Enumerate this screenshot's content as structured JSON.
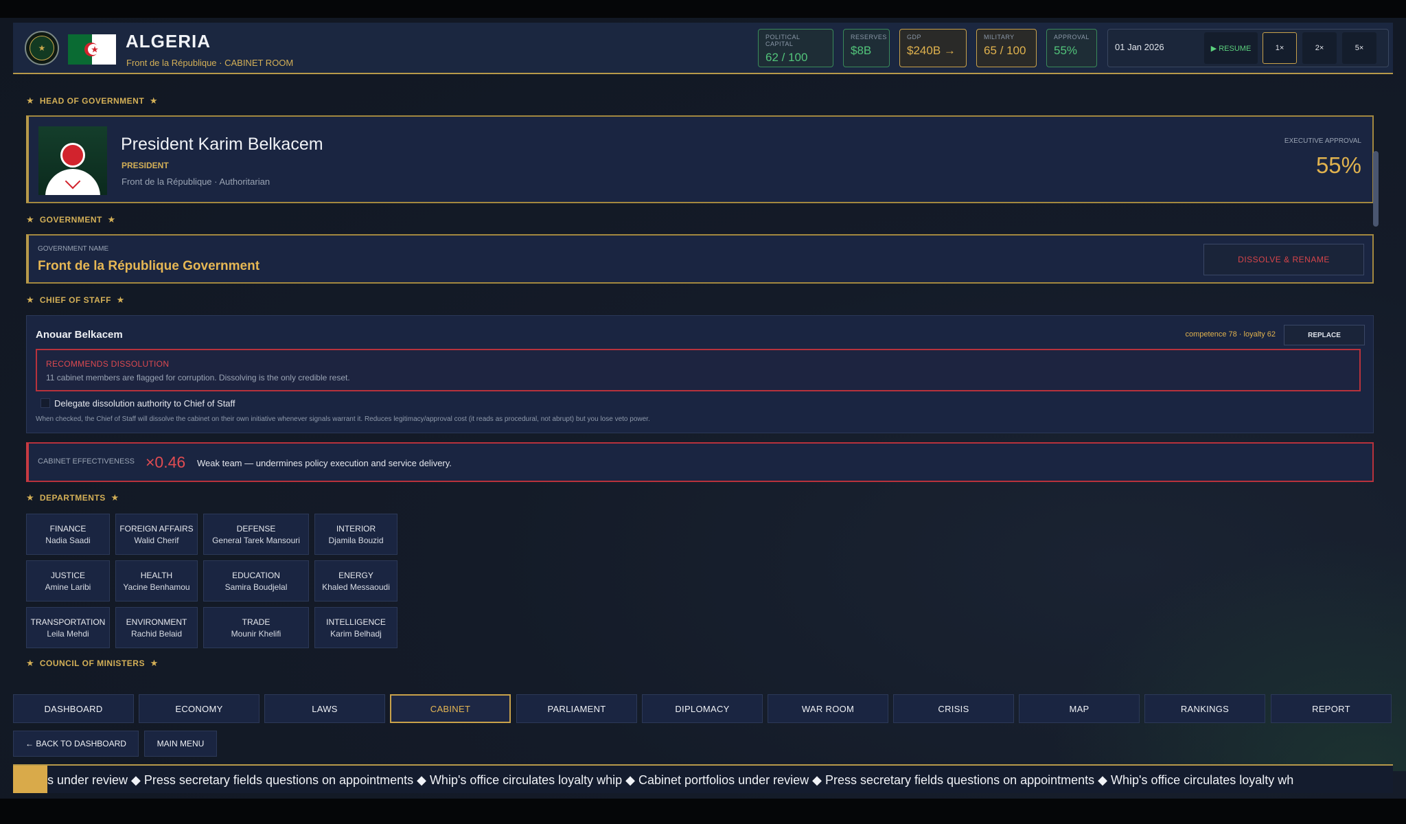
{
  "header": {
    "country": "ALGERIA",
    "subtitle": "Front de la République · CABINET ROOM",
    "stats": {
      "political_capital": {
        "label": "POLITICAL CAPITAL",
        "value": "62 / 100"
      },
      "reserves": {
        "label": "RESERVES",
        "value": "$8B"
      },
      "gdp": {
        "label": "GDP",
        "value": "$240B →"
      },
      "military": {
        "label": "MILITARY",
        "value": "65 / 100"
      },
      "approval": {
        "label": "APPROVAL",
        "value": "55%"
      }
    },
    "date": "01 Jan 2026",
    "resume": "▶ RESUME",
    "speeds": [
      "1×",
      "2×",
      "5×"
    ]
  },
  "sections": {
    "head_of_government": "HEAD OF GOVERNMENT",
    "government": "GOVERNMENT",
    "chief_of_staff": "CHIEF OF STAFF",
    "departments": "DEPARTMENTS",
    "council": "COUNCIL OF MINISTERS"
  },
  "leader": {
    "name": "President Karim Belkacem",
    "role": "PRESIDENT",
    "party": "Front de la République · Authoritarian",
    "approval_label": "EXECUTIVE APPROVAL",
    "approval_value": "55%"
  },
  "government": {
    "label": "GOVERNMENT NAME",
    "name": "Front de la République Government",
    "dissolve_button": "DISSOLVE & RENAME"
  },
  "chief_of_staff": {
    "name": "Anouar Belkacem",
    "stats": "competence 78 · loyalty 62",
    "replace_button": "REPLACE",
    "warning_title": "RECOMMENDS DISSOLUTION",
    "warning_text": "11 cabinet members are flagged for corruption. Dissolving is the only credible reset.",
    "checkbox_label": "Delegate dissolution authority to Chief of Staff",
    "checkbox_desc": "When checked, the Chief of Staff will dissolve the cabinet on their own initiative whenever signals warrant it. Reduces legitimacy/approval cost (it reads as procedural, not abrupt) but you lose veto power."
  },
  "effectiveness": {
    "label": "CABINET EFFECTIVENESS",
    "value": "×0.46",
    "desc": "Weak team — undermines policy execution and service delivery."
  },
  "departments": [
    {
      "dept": "FINANCE",
      "person": "Nadia Saadi"
    },
    {
      "dept": "FOREIGN AFFAIRS",
      "person": "Walid Cherif"
    },
    {
      "dept": "DEFENSE",
      "person": "General Tarek Mansouri"
    },
    {
      "dept": "INTERIOR",
      "person": "Djamila Bouzid"
    },
    {
      "dept": "JUSTICE",
      "person": "Amine Laribi"
    },
    {
      "dept": "HEALTH",
      "person": "Yacine Benhamou"
    },
    {
      "dept": "EDUCATION",
      "person": "Samira Boudjelal"
    },
    {
      "dept": "ENERGY",
      "person": "Khaled Messaoudi"
    },
    {
      "dept": "TRANSPORTATION",
      "person": "Leila Mehdi"
    },
    {
      "dept": "ENVIRONMENT",
      "person": "Rachid Belaid"
    },
    {
      "dept": "TRADE",
      "person": "Mounir Khelifi"
    },
    {
      "dept": "INTELLIGENCE",
      "person": "Karim Belhadj"
    }
  ],
  "tabs": [
    "DASHBOARD",
    "ECONOMY",
    "LAWS",
    "CABINET",
    "PARLIAMENT",
    "DIPLOMACY",
    "WAR ROOM",
    "CRISIS",
    "MAP",
    "RANKINGS",
    "REPORT"
  ],
  "active_tab": "CABINET",
  "nav": {
    "back": "← BACK TO DASHBOARD",
    "main_menu": "MAIN MENU"
  },
  "ticker": "s under review  ◆  Press secretary fields questions on appointments  ◆  Whip's office circulates loyalty whip  ◆  Cabinet portfolios under review  ◆  Press secretary fields questions on appointments  ◆  Whip's office circulates loyalty wh",
  "colors": {
    "accent_gold": "#d4b057",
    "alert_red": "#de4a50",
    "positive_green": "#52c47a",
    "panel": "#1a2541"
  }
}
